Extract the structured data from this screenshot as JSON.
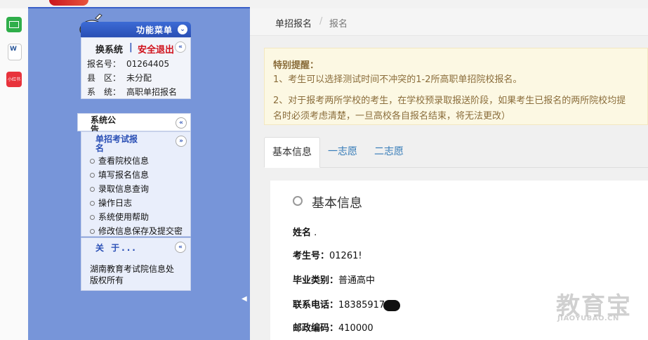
{
  "dock": {
    "red_app_label": "小红书"
  },
  "sidebar": {
    "menu_title": "功能菜单",
    "switch_system": "换系统",
    "separator": "|",
    "logout": "安全退出",
    "info": [
      {
        "key": "报名号：",
        "value": "01264405"
      },
      {
        "key": "县　区：",
        "value": "未分配"
      },
      {
        "key": "系　统：",
        "value": "高职单招报名"
      }
    ],
    "announcement_title": "系统公告",
    "exam_title": "单招考试报名",
    "exam_items": [
      "查看院校信息",
      "填写报名信息",
      "录取信息查询",
      "操作日志",
      "系统使用帮助",
      "修改信息保存及提交密"
    ],
    "about_title": "关 于...",
    "about_text": "湖南教育考试院信息处版权所有",
    "collapse_glyph": "«",
    "expand_glyph": "»",
    "down_glyph": "⌄",
    "side_arrow": "◀"
  },
  "breadcrumb": {
    "parent": "单招报名",
    "divider": "/",
    "current": "报名"
  },
  "notice": {
    "title": "特别提醒：",
    "line1": "1、考生可以选择测试时间不冲突的1-2所高职单招院校报名。",
    "line2": "2、对于报考两所学校的考生，在学校预录取报送阶段，如果考生已报名的两所院校均提",
    "line3": "名时必须考虑清楚，一旦高校各自报名结束，将无法更改）"
  },
  "tabs": [
    "基本信息",
    "一志愿",
    "二志愿"
  ],
  "basic_info": {
    "heading": "基本信息",
    "fields": [
      {
        "label": "姓名",
        "value": "."
      },
      {
        "label": "考生号：",
        "value": "01261!"
      },
      {
        "label": "毕业类别：",
        "value": "普通高中"
      },
      {
        "label": "联系电话：",
        "value": "18385917"
      },
      {
        "label": "邮政编码：",
        "value": "410000"
      }
    ]
  },
  "watermark": {
    "main": "教育宝",
    "url": "JIAOYUBAO.CN"
  }
}
